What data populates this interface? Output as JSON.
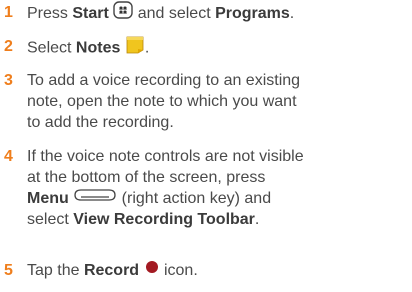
{
  "steps": [
    {
      "number": "1",
      "p1": "Press ",
      "b1": "Start",
      "p2": " and select ",
      "b2": "Programs",
      "p3": ".",
      "icon": "start-key-icon"
    },
    {
      "number": "2",
      "p1": "Select ",
      "b1": "Notes",
      "p2": ".",
      "icon": "notes-app-icon"
    },
    {
      "number": "3",
      "lines": [
        "To add a voice recording to an existing",
        "note, open the note to which you want",
        "to add the recording."
      ]
    },
    {
      "number": "4",
      "l1": "If the voice note controls are not visible",
      "l2": "at the bottom of the screen, press",
      "b1": "Menu",
      "p1": " (right action key) and",
      "p2": "select ",
      "b2": "View Recording Toolbar",
      "p3": ".",
      "icon": "right-action-key-icon"
    },
    {
      "number": "5",
      "p1": "Tap the ",
      "b1": "Record",
      "p2": " icon.",
      "icon": "record-icon"
    }
  ],
  "colors": {
    "step_number": "#ef7e1c",
    "text": "#4a4a4a",
    "notes_icon": "#f0c51e",
    "record_dot": "#a31a22"
  }
}
